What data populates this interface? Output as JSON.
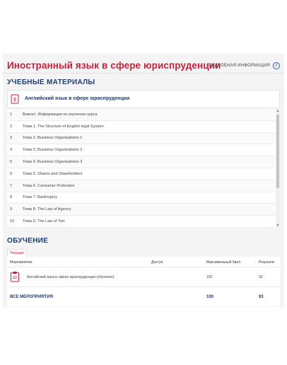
{
  "header": {
    "course_title": "Иностранный язык в сфере юриспруденции",
    "more_info": "ПОДРОБНАЯ ИНФОРМАЦИЯ"
  },
  "materials": {
    "heading": "УЧЕБНЫЕ МАТЕРИАЛЫ",
    "card_title": "Английский язык в сфере юриспруденции",
    "items": [
      {
        "num": "1",
        "name": "Важно!. Информация по изучению курса"
      },
      {
        "num": "2",
        "name": "Тема 1. The Structure of English legal System"
      },
      {
        "num": "3",
        "name": "Тема 2. Business Organisations 1"
      },
      {
        "num": "4",
        "name": "Тема 3. Business Organisations 2"
      },
      {
        "num": "5",
        "name": "Тема 4. Business Organisations 3"
      },
      {
        "num": "6",
        "name": "Тема 5. Shares and Shareholders"
      },
      {
        "num": "7",
        "name": "Тема 6. Consumer Protection"
      },
      {
        "num": "8",
        "name": "Тема 7. Bankruptcy"
      },
      {
        "num": "9",
        "name": "Тема 8. The Law of Agency"
      },
      {
        "num": "10",
        "name": "Тема 9. The Law of Tort"
      }
    ]
  },
  "learning": {
    "heading": "ОБУЧЕНИЕ",
    "tab_current": "Текущие",
    "columns": {
      "event": "Мероприятие",
      "access": "Доступ",
      "max_score": "Максимальный балл",
      "result": "Результат"
    },
    "rows": [
      {
        "event": "Английский язык в сфере юриспруденции (обучение)",
        "access": "",
        "max_score": "100",
        "result": "93"
      }
    ],
    "total": {
      "label": "ВСЕ МЕРОПРИЯТИЯ",
      "max_score": "100",
      "result": "93"
    }
  },
  "colors": {
    "accent": "#c2233b",
    "heading": "#1f3b6b",
    "icon": "#2a5ea8"
  }
}
